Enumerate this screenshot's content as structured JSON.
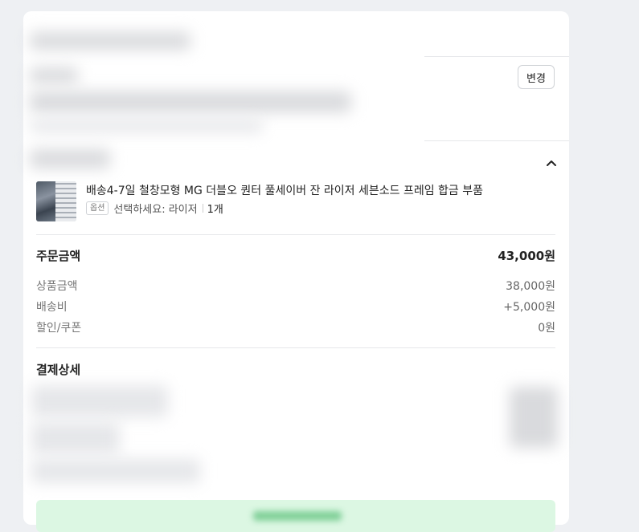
{
  "shipping": {
    "change_label": "변경"
  },
  "product": {
    "title": "배송4-7일 철창모형 MG 더블오 퀀터 풀세이버 잔 라이저 세븐소드 프레임 합금 부품",
    "option_badge": "옵션",
    "option_text": "선택하세요: 라이저",
    "quantity": "1개"
  },
  "summary": {
    "order_amount_label": "주문금액",
    "order_amount_value": "43,000원",
    "items": [
      {
        "label": "상품금액",
        "value": "38,000원"
      },
      {
        "label": "배송비",
        "value": "+5,000원"
      },
      {
        "label": "할인/쿠폰",
        "value": "0원"
      }
    ]
  },
  "payment": {
    "section_title": "결제상세"
  },
  "icons": {
    "collapse": "chevron-up-icon",
    "thumbnail": "product-thumbnail"
  }
}
